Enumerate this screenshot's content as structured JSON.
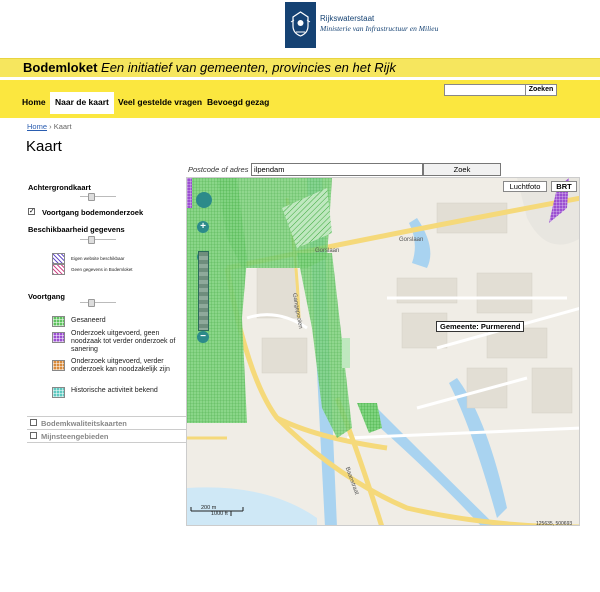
{
  "header": {
    "org_name": "Rijkswaterstaat",
    "ministry": "Ministerie van Infrastructuur en Milieu",
    "brand": "Bodemloket",
    "tagline": "Een initiatief van gemeenten, provincies en het Rijk"
  },
  "nav": {
    "items": [
      {
        "label": "Home",
        "active": false
      },
      {
        "label": "Naar de kaart",
        "active": true
      },
      {
        "label": "Veel gestelde vragen",
        "active": false
      },
      {
        "label": "Bevoegd gezag",
        "active": false
      }
    ],
    "search_value": "",
    "search_button": "Zoeken"
  },
  "breadcrumb": {
    "home": "Home",
    "separator": "›",
    "current": "Kaart"
  },
  "page_title": "Kaart",
  "address_search": {
    "label": "Postcode of adres",
    "value": "ilpendam",
    "button": "Zoek"
  },
  "sidebar": {
    "achtergrondkaart": "Achtergrondkaart",
    "voortgang_checkbox": "Voortgang bodemonderzoek",
    "beschikbaarheid_heading": "Beschikbaarheid gegevens",
    "beschikbaarheid_items": [
      "Eigen website beschikbaar",
      "Geen gegevens in Bodemloket"
    ],
    "voortgang_heading": "Voortgang",
    "voortgang_items": [
      {
        "label": "Gesaneerd",
        "color": "#5ec25e"
      },
      {
        "label": "Onderzoek uitgevoerd, geen noodzaak tot verder onderzoek of sanering",
        "color": "#9b4fd1"
      },
      {
        "label": "Onderzoek uitgevoerd, verder onderzoek kan noodzakelijk zijn",
        "color": "#d98a3a"
      },
      {
        "label": "Historische activiteit bekend",
        "color": "#5ec9c0"
      }
    ],
    "bodemkwaliteitskaarten": "Bodemkwaliteitskaarten",
    "mijnsteengebieden": "Mijnsteengebieden"
  },
  "map": {
    "btn_luchtfoto": "Luchtfoto",
    "btn_brt": "BRT",
    "municipality": "Gemeente: Purmerend",
    "roads": [
      "Gorslaan",
      "Gorslaan",
      "Gangepoolen",
      "Baanstraat"
    ],
    "scale_m": "200 m",
    "scale_ft": "1000 ft",
    "coordinates": "125635, 500693",
    "zoom_level": 3
  },
  "colors": {
    "title_bar": "#f6e65e",
    "nav_bar": "#fbe73f",
    "logo_blue": "#154273",
    "voortgang_green": "#5ec25e"
  }
}
